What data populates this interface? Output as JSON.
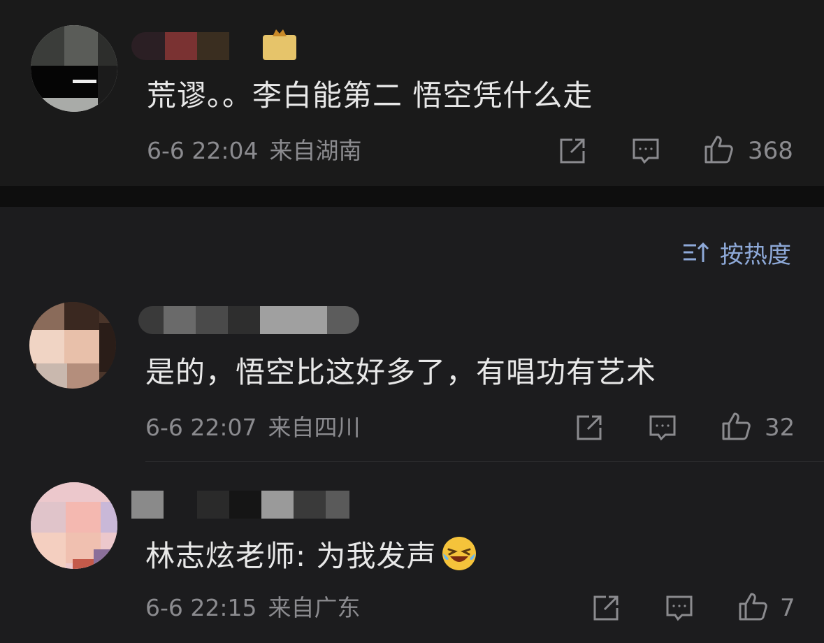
{
  "sort": {
    "label": "按热度"
  },
  "comments": [
    {
      "text": "荒谬。。李白能第二 悟空凭什么走",
      "time": "6-6 22:04",
      "location": "来自湖南",
      "likes": "368",
      "has_badge": true
    },
    {
      "text": "是的，悟空比这好多了，有唱功有艺术",
      "time": "6-6 22:07",
      "location": "来自四川",
      "likes": "32"
    },
    {
      "text": "林志炫老师: 为我发声",
      "emoji": "rofl-emoji",
      "time": "6-6 22:15",
      "location": "来自广东",
      "likes": "7"
    }
  ],
  "icons": {
    "share": "share-icon",
    "reply": "comment-icon",
    "like": "thumbs-up-icon",
    "sort": "sort-icon"
  },
  "colors": {
    "accent": "#8ea9d8",
    "text": "#e8e8e8",
    "meta": "#8b8b8f",
    "background": "#1c1c1e"
  }
}
